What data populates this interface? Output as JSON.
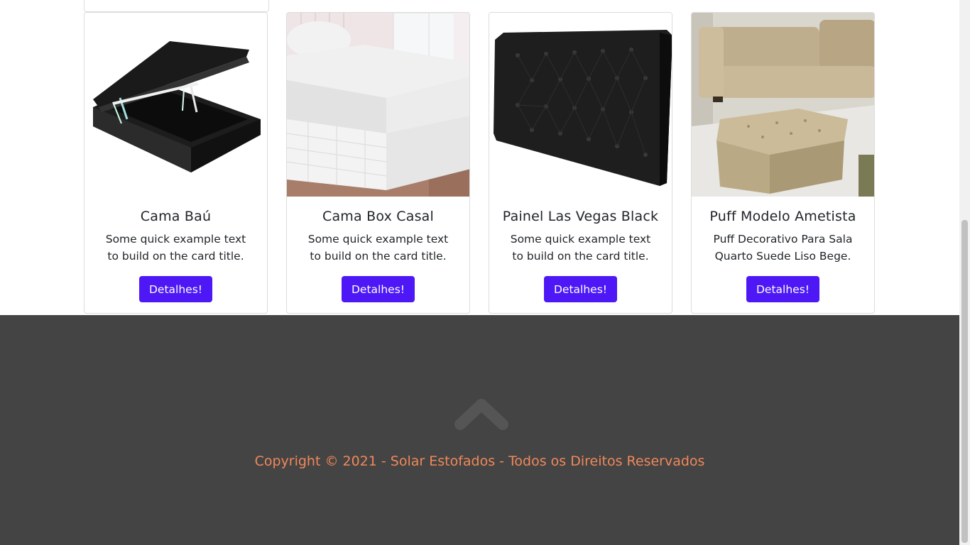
{
  "products": [
    {
      "title": "Cama Baú",
      "text": "Some quick example text to build on the card title.",
      "button": "Detalhes!",
      "image_icon": "storage-bed-icon"
    },
    {
      "title": "Cama Box Casal",
      "text": "Some quick example text to build on the card title.",
      "button": "Detalhes!",
      "image_icon": "box-bed-icon"
    },
    {
      "title": "Painel Las Vegas Black",
      "text": "Some quick example text to build on the card title.",
      "button": "Detalhes!",
      "image_icon": "headboard-icon"
    },
    {
      "title": "Puff Modelo Ametista",
      "text": "Puff Decorativo Para Sala Quarto Suede Liso Bege.",
      "button": "Detalhes!",
      "image_icon": "puff-icon"
    }
  ],
  "footer": {
    "copyright": "Copyright © 2021 - Solar Estofados - Todos os Direitos Reservados",
    "up_icon": "chevron-up-icon"
  },
  "colors": {
    "button": "#4d18f5",
    "footer_bg": "#444444",
    "copyright": "#f0885a"
  }
}
